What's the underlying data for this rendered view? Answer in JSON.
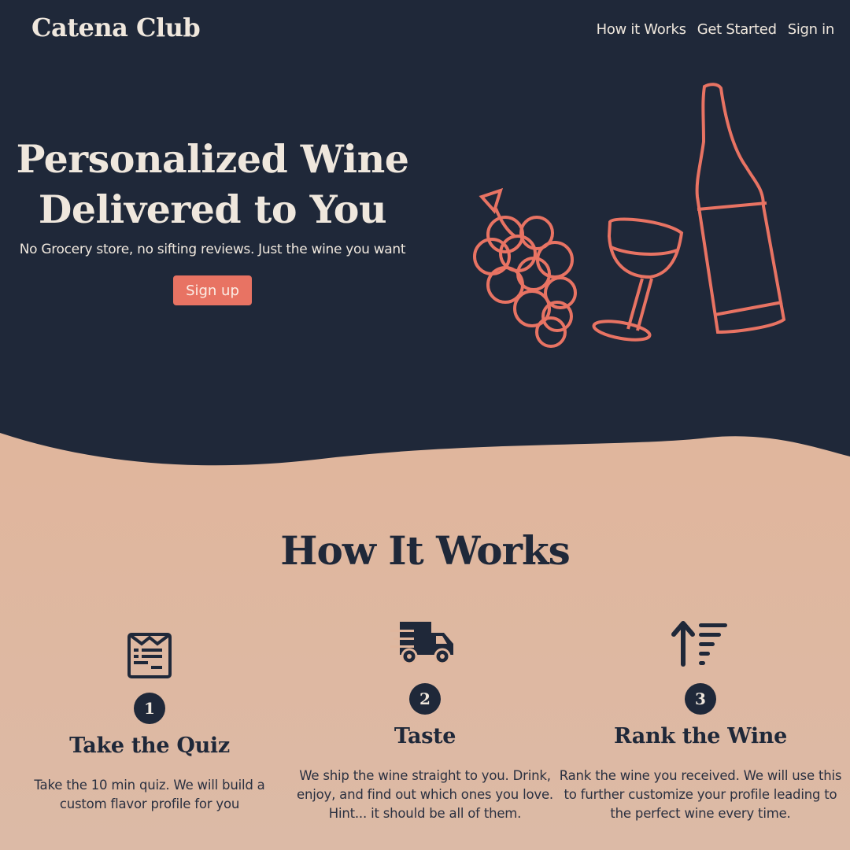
{
  "nav": {
    "logo": "Catena Club",
    "links": [
      "How it Works",
      "Get Started",
      "Sign in"
    ]
  },
  "hero": {
    "title_line1": "Personalized Wine",
    "title_line2": "Delivered to You",
    "subtitle": "No Grocery store, no sifting reviews. Just the wine you want",
    "cta_label": "Sign up",
    "illustration": [
      "grapes-icon",
      "wine-glass-icon",
      "wine-bottle-icon"
    ]
  },
  "how_it_works": {
    "title": "How It Works",
    "steps": [
      {
        "number": "1",
        "icon": "quiz-icon",
        "title": "Take the Quiz",
        "description": "Take the 10 min quiz. We will build a custom flavor profile for you"
      },
      {
        "number": "2",
        "icon": "delivery-truck-icon",
        "title": "Taste",
        "description": "We ship the wine straight to you. Drink, enjoy, and find out which ones you love. Hint... it should be all of them."
      },
      {
        "number": "3",
        "icon": "sort-ascending-icon",
        "title": "Rank the Wine",
        "description": "Rank the wine you received. We will use this to further customize your profile leading to the perfect wine every time."
      }
    ]
  },
  "colors": {
    "navy": "#1f2839",
    "accent": "#e87363",
    "cream": "#efe7dd",
    "peach": "#e0b69d"
  }
}
